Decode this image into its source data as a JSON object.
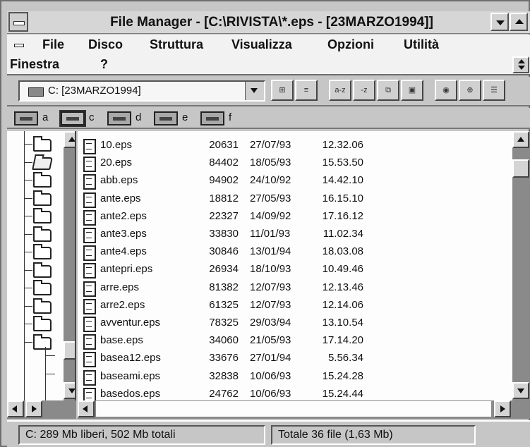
{
  "window": {
    "title": "File Manager - [C:\\RIVISTA\\*.eps - [23MARZO1994]]"
  },
  "menu": {
    "items": [
      {
        "label": "File"
      },
      {
        "label": "Disco"
      },
      {
        "label": "Struttura"
      },
      {
        "label": "Visualizza"
      },
      {
        "label": "Opzioni"
      },
      {
        "label": "Utilità"
      }
    ],
    "finestra": "Finestra",
    "help": "?"
  },
  "toolbar": {
    "drive_combo": "C: [23MARZO1994]",
    "buttons": [
      {
        "icon": "tree-and-directory-view-icon",
        "glyph": "⊞"
      },
      {
        "icon": "directory-only-view-icon",
        "glyph": "≡"
      },
      {
        "icon": "sort-by-name-icon",
        "glyph": "a-z"
      },
      {
        "icon": "sort-by-type-icon",
        "glyph": "-z"
      },
      {
        "icon": "copy-disk-icon",
        "glyph": "⧉"
      },
      {
        "icon": "new-window-icon",
        "glyph": "▣"
      },
      {
        "icon": "connect-network-drive-icon",
        "glyph": "◉"
      },
      {
        "icon": "disconnect-network-drive-icon",
        "glyph": "⊕"
      },
      {
        "icon": "share-as-icon",
        "glyph": "☰"
      }
    ]
  },
  "drives": [
    {
      "letter": "a",
      "selected": false
    },
    {
      "letter": "c",
      "selected": true
    },
    {
      "letter": "d",
      "selected": false
    },
    {
      "letter": "e",
      "selected": false
    },
    {
      "letter": "f",
      "selected": false
    }
  ],
  "tree": {
    "folders": [
      {
        "open": false
      },
      {
        "open": true
      },
      {
        "open": false
      },
      {
        "open": false
      },
      {
        "open": false
      },
      {
        "open": false
      },
      {
        "open": false
      },
      {
        "open": false
      },
      {
        "open": false
      },
      {
        "open": false
      },
      {
        "open": false
      },
      {
        "open": false
      }
    ]
  },
  "files": [
    {
      "name": "10.eps",
      "size": "20631",
      "date": "27/07/93",
      "time": "12.32.06"
    },
    {
      "name": "20.eps",
      "size": "84402",
      "date": "18/05/93",
      "time": "15.53.50"
    },
    {
      "name": "abb.eps",
      "size": "94902",
      "date": "24/10/92",
      "time": "14.42.10"
    },
    {
      "name": "ante.eps",
      "size": "18812",
      "date": "27/05/93",
      "time": "16.15.10"
    },
    {
      "name": "ante2.eps",
      "size": "22327",
      "date": "14/09/92",
      "time": "17.16.12"
    },
    {
      "name": "ante3.eps",
      "size": "33830",
      "date": "11/01/93",
      "time": "11.02.34"
    },
    {
      "name": "ante4.eps",
      "size": "30846",
      "date": "13/01/94",
      "time": "18.03.08"
    },
    {
      "name": "antepri.eps",
      "size": "26934",
      "date": "18/10/93",
      "time": "10.49.46"
    },
    {
      "name": "arre.eps",
      "size": "81382",
      "date": "12/07/93",
      "time": "12.13.46"
    },
    {
      "name": "arre2.eps",
      "size": "61325",
      "date": "12/07/93",
      "time": "12.14.06"
    },
    {
      "name": "avventur.eps",
      "size": "78325",
      "date": "29/03/94",
      "time": "13.10.54"
    },
    {
      "name": "base.eps",
      "size": "34060",
      "date": "21/05/93",
      "time": "17.14.20"
    },
    {
      "name": "basea12.eps",
      "size": "33676",
      "date": "27/01/94",
      "time": "5.56.34"
    },
    {
      "name": "baseami.eps",
      "size": "32838",
      "date": "10/06/93",
      "time": "15.24.28"
    },
    {
      "name": "basedos.eps",
      "size": "24762",
      "date": "10/06/93",
      "time": "15.24.44"
    }
  ],
  "status": {
    "disk": "C: 289 Mb liberi,  502 Mb totali",
    "selection": "Totale 36 file (1,63 Mb)"
  }
}
